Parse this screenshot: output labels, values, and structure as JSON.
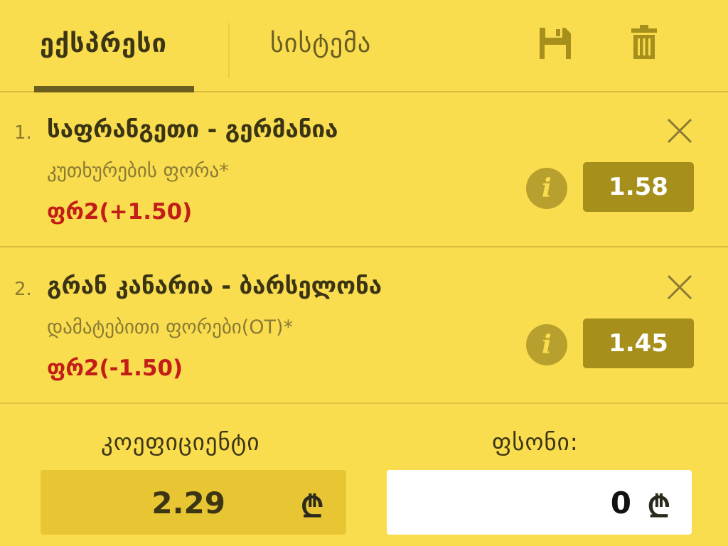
{
  "tabs": {
    "express": "ექსპრესი",
    "system": "სისტემა"
  },
  "icons": {
    "save": "save-icon",
    "trash": "trash-icon",
    "close": "close-icon",
    "info": "info-icon"
  },
  "colors": {
    "background": "#f9dd4f",
    "accent": "#a68f1b",
    "pick": "#c21e17"
  },
  "bets": [
    {
      "number": "1.",
      "match": "საფრანგეთი - გერმანია",
      "market": "კუთხურების ფორა*",
      "pick": "ფრ2(+1.50)",
      "info": "i",
      "odds": "1.58"
    },
    {
      "number": "2.",
      "match": "გრან კანარია - ბარსელონა",
      "market": "დამატებითი ფორები(OT)*",
      "pick": "ფრ2(-1.50)",
      "info": "i",
      "odds": "1.45"
    }
  ],
  "footer": {
    "coefficient_label": "კოეფიციენტი",
    "coefficient_value": "2.29",
    "stake_label": "ფსონი:",
    "stake_value": "0",
    "currency": "₾"
  }
}
